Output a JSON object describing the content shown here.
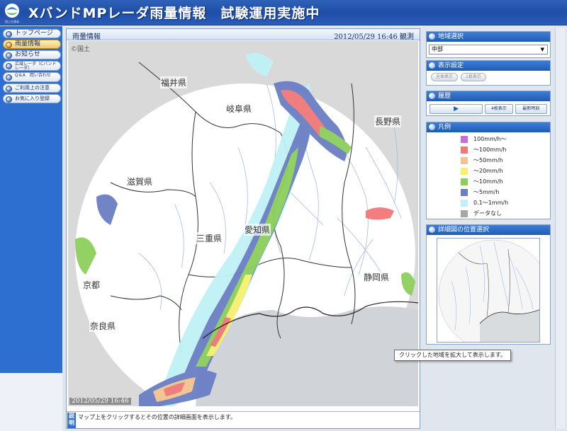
{
  "header": {
    "title": "XバンドMPレーダ雨量情報　試験運用実施中",
    "logo_caption": "国土交通省"
  },
  "nav": {
    "items": [
      {
        "label": "トップページ",
        "active": false
      },
      {
        "label": "雨量情報",
        "active": true
      },
      {
        "label": "お知らせ",
        "active": false
      },
      {
        "label": "広域レーダ（Cバンドレーダ）",
        "active": false
      },
      {
        "label": "Q＆A　問い合わせ",
        "active": false
      },
      {
        "label": "ご利用上の注意",
        "active": false
      },
      {
        "label": "お気に入り登録",
        "active": false
      }
    ]
  },
  "main": {
    "title": "雨量情報",
    "observed_time": "2012/05/29 16:46 観測",
    "map_copyright": "©国土",
    "map_stamp": "2012/05/29 16:46",
    "prefectures": [
      "福井県",
      "岐阜県",
      "長野県",
      "滋賀県",
      "三重県",
      "愛知県",
      "静岡県",
      "京都",
      "奈良県"
    ],
    "hint_tag": "説明",
    "hint_text": "マップ上をクリックするとその位置の詳細画面を表示します。"
  },
  "region": {
    "title": "地域選択",
    "selected": "中部"
  },
  "display": {
    "title": "表示設定",
    "buttons": [
      "全体表示",
      "1枚表示"
    ]
  },
  "history": {
    "title": "履歴",
    "play_icon": "play-icon",
    "buttons": [
      "4枚表示",
      "最新時刻"
    ]
  },
  "legend": {
    "title": "凡例",
    "items": [
      {
        "label": "100mm/h～",
        "color": "#c76fd6"
      },
      {
        "label": "～100mm/h",
        "color": "#f07878"
      },
      {
        "label": "～50mm/h",
        "color": "#f2c290"
      },
      {
        "label": "～20mm/h",
        "color": "#f6f06e"
      },
      {
        "label": "～10mm/h",
        "color": "#8ccf5c"
      },
      {
        "label": "～5mm/h",
        "color": "#6a7ec4"
      },
      {
        "label": "0.1～1mm/h",
        "color": "#bff1f6"
      },
      {
        "label": "データなし",
        "color": "#a6a6a6"
      }
    ]
  },
  "detail": {
    "title": "詳細図の位置選択"
  },
  "tooltip": {
    "text": "クリックした地域を拡大して表示します。"
  }
}
